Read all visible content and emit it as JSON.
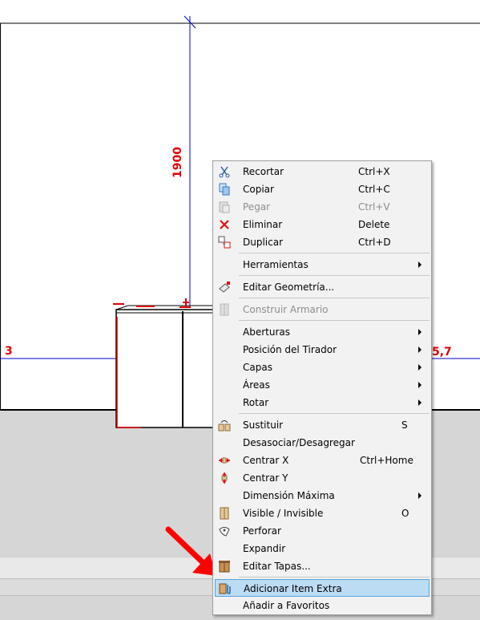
{
  "drawing": {
    "dimension_height": "1900",
    "dimension_left": "3",
    "dimension_right": "5,7"
  },
  "menu": {
    "items": [
      {
        "label": "Recortar",
        "shortcut": "Ctrl+X",
        "icon": "scissors-icon"
      },
      {
        "label": "Copiar",
        "shortcut": "Ctrl+C",
        "icon": "copy-icon"
      },
      {
        "label": "Pegar",
        "shortcut": "Ctrl+V",
        "icon": "paste-icon",
        "disabled": true
      },
      {
        "label": "Eliminar",
        "shortcut": "Delete",
        "icon": "delete-x-icon"
      },
      {
        "label": "Duplicar",
        "shortcut": "Ctrl+D",
        "icon": "duplicate-icon"
      },
      {
        "label": "Herramientas",
        "submenu": true
      },
      {
        "label": "Editar Geometría...",
        "icon": "eraser-icon"
      },
      {
        "label": "Construir Armario",
        "icon": "cabinet-icon",
        "disabled": true
      },
      {
        "label": "Aberturas",
        "submenu": true
      },
      {
        "label": "Posición del Tirador",
        "submenu": true
      },
      {
        "label": "Capas",
        "submenu": true
      },
      {
        "label": "Áreas",
        "submenu": true
      },
      {
        "label": "Rotar",
        "submenu": true
      },
      {
        "label": "Sustituir",
        "shortcut": "S",
        "icon": "replace-icon"
      },
      {
        "label": "Desasociar/Desagregar"
      },
      {
        "label": "Centrar X",
        "shortcut": "Ctrl+Home",
        "icon": "center-x-icon"
      },
      {
        "label": "Centrar Y",
        "icon": "center-y-icon"
      },
      {
        "label": "Dimensión Máxima",
        "submenu": true
      },
      {
        "label": "Visible / Invisible",
        "shortcut": "O",
        "icon": "visibility-icon"
      },
      {
        "label": "Perforar",
        "icon": "drill-icon"
      },
      {
        "label": "Expandir"
      },
      {
        "label": "Editar Tapas...",
        "icon": "edit-covers-icon"
      },
      {
        "label": "Adicionar Item Extra",
        "icon": "add-extra-item-icon",
        "highlighted": true
      },
      {
        "label": "Añadir a Favoritos"
      }
    ]
  },
  "colors": {
    "dimension": "#e00000",
    "guide_line": "#0000c8",
    "highlight": "#bcdcf4",
    "annotation_arrow": "#ff0000"
  }
}
